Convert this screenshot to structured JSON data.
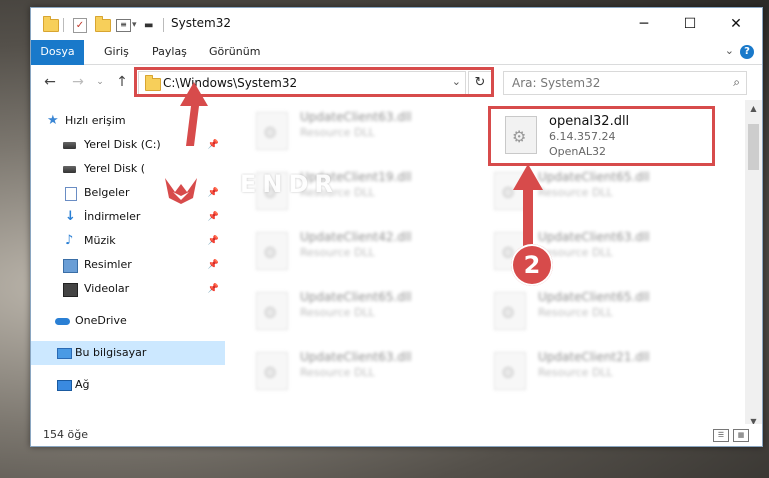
{
  "window": {
    "title": "System32"
  },
  "controls": {
    "minimize": "─",
    "maximize": "☐",
    "close": "✕"
  },
  "ribbon": {
    "tabs": [
      "Dosya",
      "Giriş",
      "Paylaş",
      "Görünüm"
    ],
    "help": "?"
  },
  "nav": {
    "address": "C:\\Windows\\System32",
    "search_placeholder": "Ara: System32"
  },
  "sidebar": {
    "items": [
      {
        "label": "Hızlı erişim",
        "icon": "star-icon"
      },
      {
        "label": "Yerel Dis⁠k (C:)",
        "icon": "drive-icon"
      },
      {
        "label": "Yerel Disk (",
        "icon": "drive-icon"
      },
      {
        "label": "Belgeler",
        "icon": "document-icon"
      },
      {
        "label": "İndirmeler",
        "icon": "download-icon"
      },
      {
        "label": "Müzik",
        "icon": "music-icon"
      },
      {
        "label": "Resimler",
        "icon": "pictures-icon"
      },
      {
        "label": "Videolar",
        "icon": "videos-icon"
      },
      {
        "label": "OneDrive",
        "icon": "cloud-icon"
      },
      {
        "label": "Bu bilgisayar",
        "icon": "computer-icon"
      },
      {
        "label": "Ağ",
        "icon": "network-icon"
      }
    ]
  },
  "files": [
    {
      "name": "UpdateClient63.dll",
      "type": "Resource DLL"
    },
    {
      "name": "openal32.dll",
      "version": "6.14.357.24",
      "type": "OpenAL32"
    },
    {
      "name": "UpdateClient19.dll",
      "type": "Resource DLL"
    },
    {
      "name": "UpdateClient65.dll",
      "type": "Resource DLL"
    },
    {
      "name": "UpdateClient42.dll",
      "type": "Resource DLL"
    },
    {
      "name": "UpdateClient63.dll",
      "type": "Resource DLL"
    },
    {
      "name": "UpdateClient65.dll",
      "type": "Resource DLL"
    },
    {
      "name": "UpdateClient65.dll",
      "type": "Resource DLL"
    },
    {
      "name": "UpdateClient63.dll",
      "type": "Resource DLL"
    },
    {
      "name": "UpdateClient21.dll",
      "type": "Resource DLL"
    }
  ],
  "status": {
    "count": "154 öğe"
  },
  "annotation": {
    "step": "2",
    "watermark": "ENDR"
  },
  "colors": {
    "accent": "#1979ca",
    "highlight": "#d74b4b",
    "selection": "#cce8ff"
  }
}
